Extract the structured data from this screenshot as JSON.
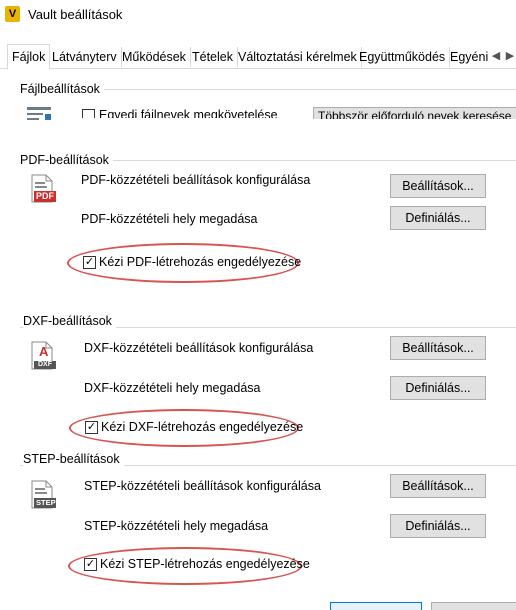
{
  "window": {
    "title": "Vault beállítások",
    "app_icon": "V"
  },
  "tabs": [
    "Fájlok",
    "Látványterv",
    "Működések",
    "Tételek",
    "Változtatási kérelmek",
    "Együttműködés",
    "Egyéni"
  ],
  "file_settings": {
    "group_label": "Fájlbeállítások",
    "unique_names_label": "Egyedi fájlnevek megkövetelése",
    "duplicates_button": "Többször előforduló nevek keresése"
  },
  "pdf": {
    "group_label": "PDF-beállítások",
    "configure_label": "PDF-közzétételi beállítások konfigurálása",
    "configure_button": "Beállítások...",
    "location_label": "PDF-közzétételi hely megadása",
    "location_button": "Definiálás...",
    "manual_label": "Kézi PDF-létrehozás engedélyezése",
    "manual_checked": true,
    "icon_text": "PDF"
  },
  "dxf": {
    "group_label": "DXF-beállítások",
    "configure_label": "DXF-közzétételi beállítások konfigurálása",
    "configure_button": "Beállítások...",
    "location_label": "DXF-közzétételi hely megadása",
    "location_button": "Definiálás...",
    "manual_label": "Kézi DXF-létrehozás engedélyezése",
    "manual_checked": true,
    "icon_text": "DXF",
    "icon_letter": "A"
  },
  "step": {
    "group_label": "STEP-beállítások",
    "configure_label": "STEP-közzétételi beállítások konfigurálása",
    "configure_button": "Beállítások...",
    "location_label": "STEP-közzétételi hely megadása",
    "location_button": "Definiálás...",
    "manual_label": "Kézi STEP-létrehozás engedélyezése",
    "manual_checked": true,
    "icon_text": "STEP"
  },
  "colors": {
    "highlight_ellipse": "#d9534f",
    "pdf_red": "#c8302c",
    "button_bg": "#e1e1e1"
  }
}
